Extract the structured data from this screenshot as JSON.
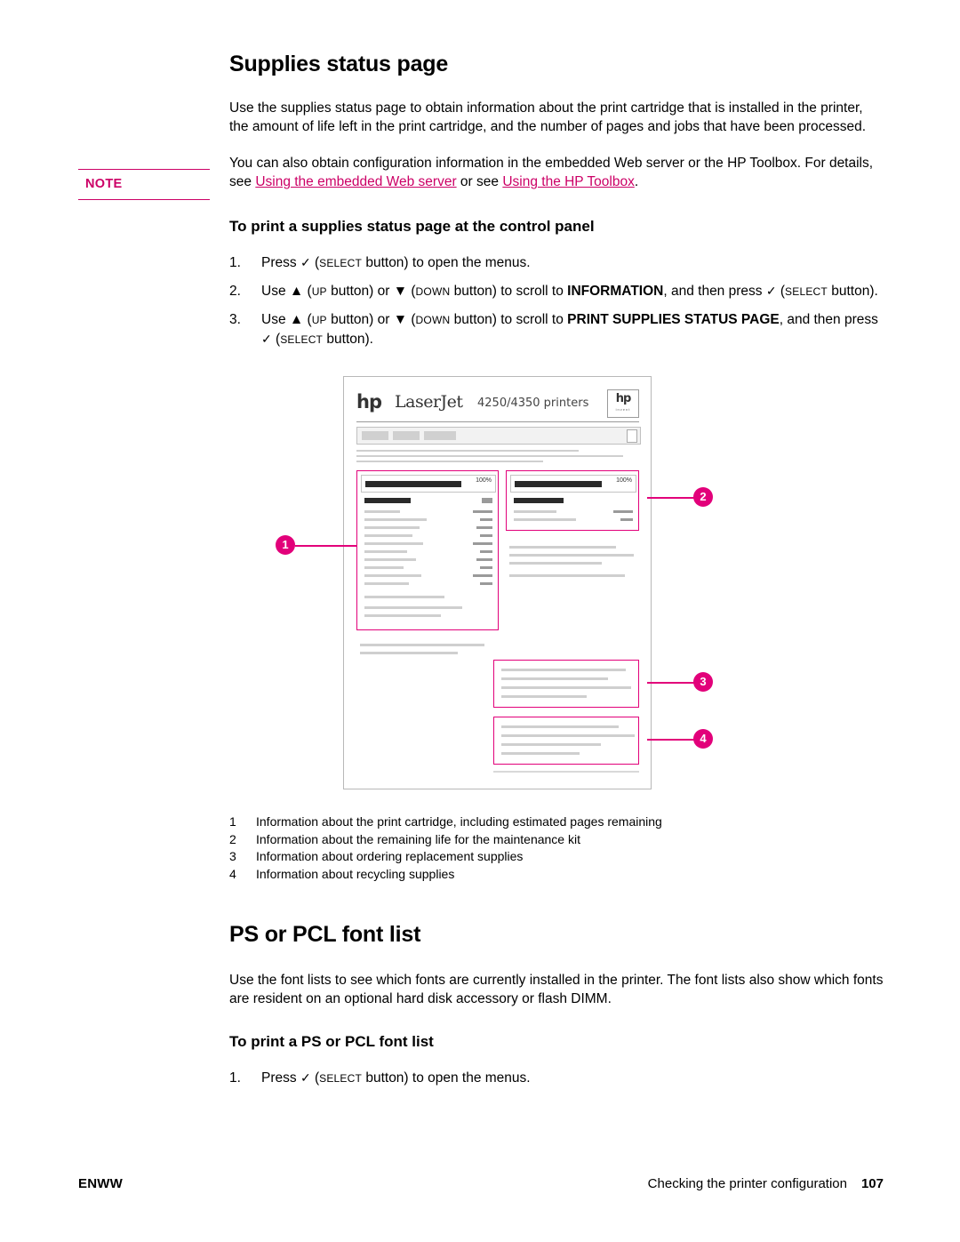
{
  "section1": {
    "title": "Supplies status page",
    "intro": "Use the supplies status page to obtain information about the print cartridge that is installed in the printer, the amount of life left in the print cartridge, and the number of pages and jobs that have been processed.",
    "note": {
      "label": "NOTE",
      "text_part1": "You can also obtain configuration information in the embedded Web server or the HP Toolbox. For details, see ",
      "link1": "Using the embedded Web server",
      "text_part2": " or see ",
      "link2": "Using the HP Toolbox",
      "text_part3": "."
    },
    "subhead": "To print a supplies status page at the control panel",
    "steps": [
      {
        "num": "1.",
        "segments": [
          {
            "type": "text",
            "text": "Press "
          },
          {
            "type": "check",
            "text": "✓"
          },
          {
            "type": "text",
            "text": " ("
          },
          {
            "type": "smallcap",
            "text": "SELECT"
          },
          {
            "type": "text",
            "text": " button) to open the menus."
          }
        ]
      },
      {
        "num": "2.",
        "segments": [
          {
            "type": "text",
            "text": "Use "
          },
          {
            "type": "text",
            "text": "▲"
          },
          {
            "type": "text",
            "text": " ("
          },
          {
            "type": "smallcap",
            "text": "UP"
          },
          {
            "type": "text",
            "text": " button) or "
          },
          {
            "type": "text",
            "text": "▼"
          },
          {
            "type": "text",
            "text": " ("
          },
          {
            "type": "smallcap",
            "text": "DOWN"
          },
          {
            "type": "text",
            "text": " button) to scroll to "
          },
          {
            "type": "bold",
            "text": "INFORMATION"
          },
          {
            "type": "text",
            "text": ", and then press "
          },
          {
            "type": "check",
            "text": "✓"
          },
          {
            "type": "text",
            "text": " ("
          },
          {
            "type": "smallcap",
            "text": "SELECT"
          },
          {
            "type": "text",
            "text": " button)."
          }
        ]
      },
      {
        "num": "3.",
        "segments": [
          {
            "type": "text",
            "text": "Use "
          },
          {
            "type": "text",
            "text": "▲"
          },
          {
            "type": "text",
            "text": " ("
          },
          {
            "type": "smallcap",
            "text": "UP"
          },
          {
            "type": "text",
            "text": " button) or "
          },
          {
            "type": "text",
            "text": "▼"
          },
          {
            "type": "text",
            "text": " ("
          },
          {
            "type": "smallcap",
            "text": "DOWN"
          },
          {
            "type": "text",
            "text": " button) to scroll to "
          },
          {
            "type": "bold",
            "text": "PRINT SUPPLIES STATUS PAGE"
          },
          {
            "type": "text",
            "text": ", and then press "
          },
          {
            "type": "check",
            "text": "✓"
          },
          {
            "type": "text",
            "text": " ("
          },
          {
            "type": "smallcap",
            "text": "SELECT"
          },
          {
            "type": "text",
            "text": " button)."
          }
        ]
      }
    ],
    "figure": {
      "printout_logo": "hp",
      "printout_brand": "LaserJet",
      "printout_model": "4250/4350 printers",
      "badge_mark": "hp",
      "badge_sub": "invent",
      "percent_left": "100%",
      "percent_right": "100%",
      "callouts": [
        "1",
        "2",
        "3",
        "4"
      ]
    },
    "legend": [
      {
        "num": "1",
        "text": "Information about the print cartridge, including estimated pages remaining"
      },
      {
        "num": "2",
        "text": "Information about the remaining life for the maintenance kit"
      },
      {
        "num": "3",
        "text": "Information about ordering replacement supplies"
      },
      {
        "num": "4",
        "text": "Information about recycling supplies"
      }
    ]
  },
  "section2": {
    "title": "PS or PCL font list",
    "intro": "Use the font lists to see which fonts are currently installed in the printer. The font lists also show which fonts are resident on an optional hard disk accessory or flash DIMM.",
    "subhead": "To print a PS or PCL font list",
    "steps": [
      {
        "num": "1.",
        "segments": [
          {
            "type": "text",
            "text": "Press "
          },
          {
            "type": "check",
            "text": "✓"
          },
          {
            "type": "text",
            "text": " ("
          },
          {
            "type": "smallcap",
            "text": "SELECT"
          },
          {
            "type": "text",
            "text": " button) to open the menus."
          }
        ]
      }
    ]
  },
  "footer": {
    "left": "ENWW",
    "right": "Checking the printer configuration",
    "page": "107"
  },
  "colors": {
    "accent": "#cc0066",
    "figure_accent": "#e2007a"
  }
}
